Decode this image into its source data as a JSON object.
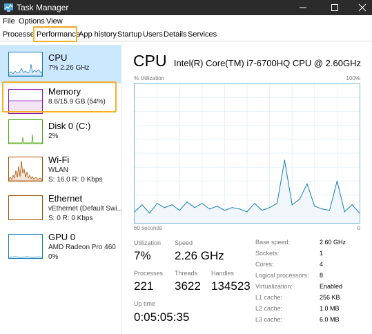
{
  "window": {
    "title": "Task Manager"
  },
  "menu": [
    "File",
    "Options",
    "View"
  ],
  "tabs": [
    {
      "label": "Processes",
      "active": false
    },
    {
      "label": "Performance",
      "active": true
    },
    {
      "label": "App history",
      "active": false
    },
    {
      "label": "Startup",
      "active": false
    },
    {
      "label": "Users",
      "active": false
    },
    {
      "label": "Details",
      "active": false
    },
    {
      "label": "Services",
      "active": false
    }
  ],
  "sidebar": [
    {
      "title": "CPU",
      "line1": "7%  2.26 GHz",
      "line2": "",
      "color": "#117dbb",
      "selected": true
    },
    {
      "title": "Memory",
      "line1": "8.6/15.9 GB (54%)",
      "line2": "",
      "color": "#8b12ae",
      "selected": false
    },
    {
      "title": "Disk 0 (C:)",
      "line1": "2%",
      "line2": "",
      "color": "#4da60c",
      "selected": false
    },
    {
      "title": "Wi-Fi",
      "line1": "WLAN",
      "line2": "S: 16.0  R: 0 Kbps",
      "color": "#a74f01",
      "selected": false
    },
    {
      "title": "Ethernet",
      "line1": "vEthernet (Default Swi...",
      "line2": "S: 0  R: 0 Kbps",
      "color": "#a74f01",
      "selected": false
    },
    {
      "title": "GPU 0",
      "line1": "AMD Radeon Pro 460",
      "line2": "0%",
      "color": "#117dbb",
      "selected": false
    }
  ],
  "main": {
    "title": "CPU",
    "model": "Intel(R) Core(TM) i7-6700HQ CPU @ 2.60GHz",
    "graph_label_left": "% Utilization",
    "graph_label_right": "100%",
    "graph_bottom_left": "60 seconds",
    "graph_bottom_right": "0",
    "stats": {
      "utilization_label": "Utilization",
      "utilization_value": "7%",
      "speed_label": "Speed",
      "speed_value": "2.26 GHz",
      "processes_label": "Processes",
      "processes_value": "221",
      "threads_label": "Threads",
      "threads_value": "3622",
      "handles_label": "Handles",
      "handles_value": "134523",
      "uptime_label": "Up time",
      "uptime_value": "0:05:05:35"
    },
    "specs": [
      {
        "label": "Base speed:",
        "value": "2.60 GHz"
      },
      {
        "label": "Sockets:",
        "value": "1"
      },
      {
        "label": "Cores:",
        "value": "4"
      },
      {
        "label": "Logical processors:",
        "value": "8"
      },
      {
        "label": "Virtualization:",
        "value": "Enabled"
      },
      {
        "label": "L1 cache:",
        "value": "256 KB"
      },
      {
        "label": "L2 cache:",
        "value": "1.0 MB"
      },
      {
        "label": "L3 cache:",
        "value": "6.0 MB"
      }
    ]
  },
  "chart_data": {
    "type": "area",
    "ylim": [
      0,
      100
    ],
    "x": [
      60,
      58,
      56,
      54,
      52,
      50,
      48,
      46,
      44,
      42,
      40,
      38,
      36,
      34,
      32,
      30,
      28,
      26,
      24,
      22,
      20,
      18,
      16,
      14,
      12,
      10,
      8,
      6,
      4,
      2,
      0
    ],
    "values": [
      8,
      13,
      7,
      14,
      11,
      13,
      9,
      15,
      11,
      14,
      10,
      12,
      9,
      11,
      10,
      8,
      14,
      9,
      11,
      14,
      45,
      13,
      17,
      28,
      12,
      10,
      9,
      30,
      8,
      13,
      7
    ]
  },
  "colors": {
    "accent": "#117dbb",
    "highlight": "#f5b027",
    "selected_bg": "#cce8ff"
  }
}
